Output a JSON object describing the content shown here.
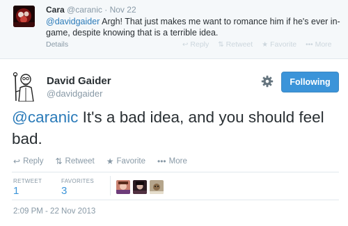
{
  "reply": {
    "name": "Cara",
    "handle": "@caranic",
    "separator": "·",
    "time": "Nov 22",
    "mention": "@davidgaider",
    "text": " Argh! That just makes me want to romance him if he's ever in-game, despite knowing that is a terrible idea.",
    "details": "Details",
    "actions": {
      "reply": "Reply",
      "retweet": "Retweet",
      "favorite": "Favorite",
      "more": "More"
    }
  },
  "tweet": {
    "author_name": "David Gaider",
    "author_handle": "@davidgaider",
    "follow_label": "Following",
    "mention": "@caranic",
    "text": " It's a bad idea, and you should feel bad.",
    "actions": {
      "reply": "Reply",
      "retweet": "Retweet",
      "favorite": "Favorite",
      "more": "More"
    },
    "stats": {
      "retweets_label": "RETWEET",
      "retweets_count": "1",
      "favorites_label": "FAVORITES",
      "favorites_count": "3"
    },
    "timestamp": "2:09 PM - 22 Nov 2013"
  },
  "icons": {
    "reply": "reply-arrow-icon",
    "retweet": "retweet-icon",
    "favorite": "star-icon",
    "more": "ellipsis-icon",
    "settings": "gear-icon"
  },
  "colors": {
    "accent": "#3b94d9",
    "link": "#2b7bb9",
    "muted": "#8899a6",
    "reply_background": "#f5f8fa"
  }
}
